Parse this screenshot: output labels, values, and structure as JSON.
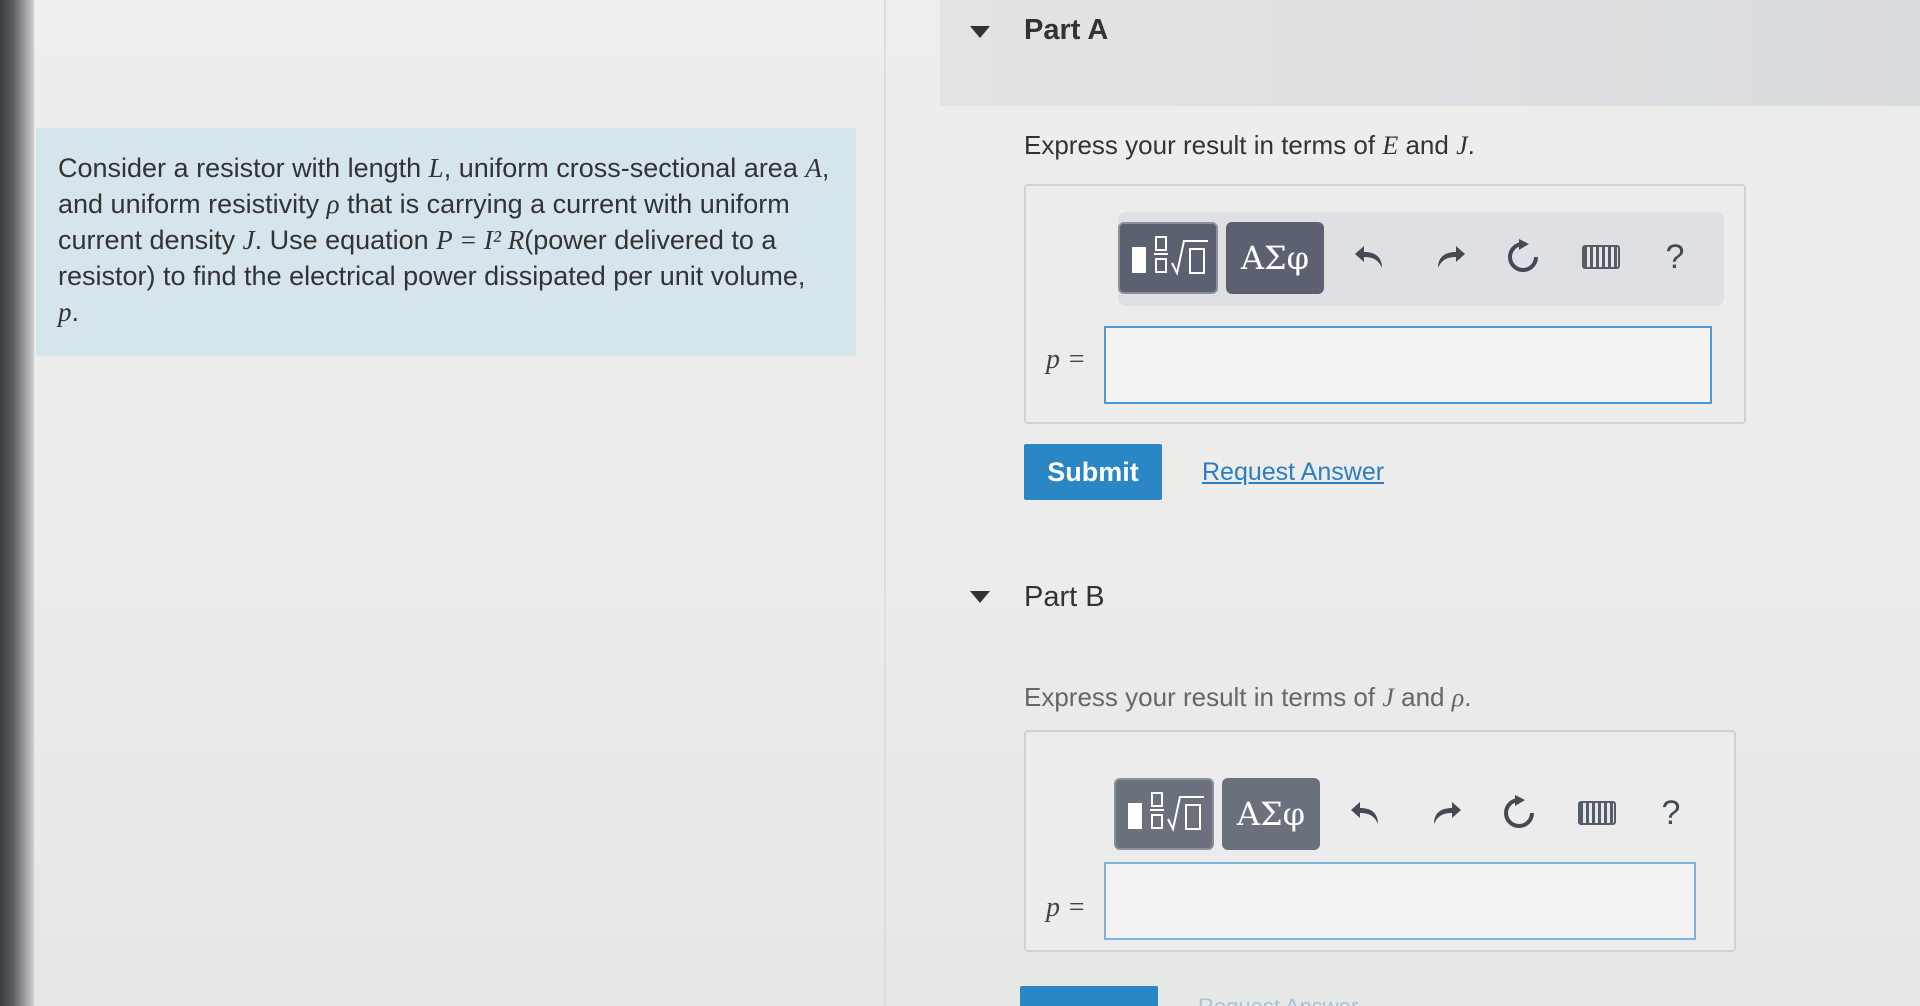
{
  "problem": {
    "t1": "Consider a resistor with length ",
    "v1": "L",
    "t2": ", uniform cross-sectional area ",
    "v2": "A",
    "t3": ", and uniform resistivity ",
    "v3": "ρ",
    "t4": " that is carrying a current with uniform current density ",
    "v4": "J",
    "t5": ". Use equation ",
    "eq": "P = I² R",
    "t6": "(power delivered to a resistor) to find the electrical power dissipated per unit volume, ",
    "v5": "p",
    "t7": "."
  },
  "part_a": {
    "title": "Part A",
    "instr_prefix": "Express your result in terms of ",
    "instr_v1": "E",
    "instr_mid": " and ",
    "instr_v2": "J",
    "instr_suffix": ".",
    "toolbar": {
      "symbols_label": "ΑΣφ",
      "help_label": "?"
    },
    "var_label": "p =",
    "input_value": "",
    "submit_label": "Submit",
    "request_label": "Request Answer"
  },
  "part_b": {
    "title": "Part B",
    "instr_prefix": "Express your result in terms of ",
    "instr_v1": "J",
    "instr_mid": " and ",
    "instr_v2": "ρ",
    "instr_suffix": ".",
    "toolbar": {
      "symbols_label": "ΑΣφ",
      "help_label": "?"
    },
    "var_label": "p =",
    "input_value": "",
    "request_label": "Request Answer"
  },
  "colors": {
    "accent": "#2b86c5",
    "panel": "#d6e5ec",
    "toolbar_button": "#5b6170"
  },
  "icons": [
    "templates-icon",
    "undo-icon",
    "redo-icon",
    "reset-icon",
    "keyboard-icon",
    "help-icon"
  ]
}
